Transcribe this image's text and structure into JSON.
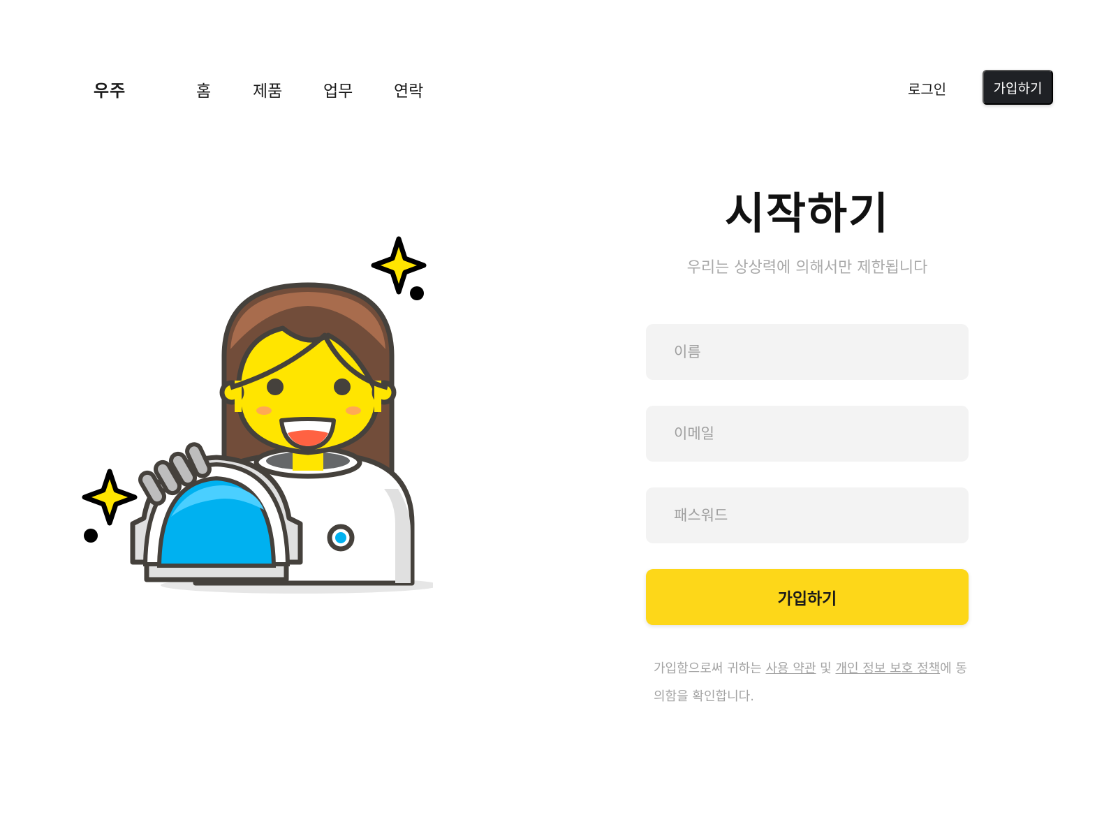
{
  "header": {
    "brand": "우주",
    "nav": [
      "홈",
      "제품",
      "업무",
      "연락"
    ],
    "login_label": "로그인",
    "signup_label": "가입하기"
  },
  "form": {
    "title": "시작하기",
    "subtitle": "우리는 상상력에 의해서만 제한됩니다",
    "name_placeholder": "이름",
    "email_placeholder": "이메일",
    "password_placeholder": "패스워드",
    "submit_label": "가입하기",
    "terms": {
      "prefix": "가입함으로써 귀하는 ",
      "terms_link": "사용 약관",
      "and": " 및 ",
      "privacy_link": "개인 정보 보호 정책",
      "suffix": "에 동의함을 확인합니다."
    }
  },
  "illustration": {
    "icon": "woman-astronaut-icon"
  },
  "colors": {
    "accent": "#fdd719",
    "dark_button": "#1f2125",
    "field_bg": "#f3f3f3",
    "muted_text": "#a9a9a9",
    "helmet_blue": "#00b1f0",
    "hair_brown": "#724d3a",
    "skin_yellow": "#ffe500"
  }
}
